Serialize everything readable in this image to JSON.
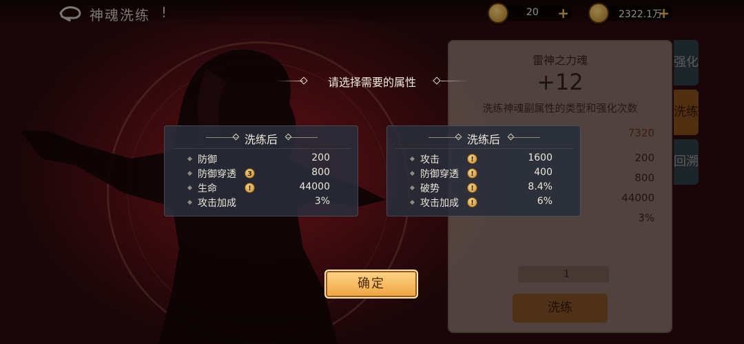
{
  "header": {
    "title": "神魂洗练",
    "title_mark": "!",
    "currencies": [
      {
        "name": "gem",
        "value": "20"
      },
      {
        "name": "gold",
        "value": "2322.1万"
      }
    ]
  },
  "side_panel": {
    "soul_name": "雷神之力魂",
    "level": "+12",
    "description": "洗练神魂副属性的类型和强化次数",
    "values": [
      "7320",
      "200",
      "800",
      "44000",
      "3%"
    ],
    "cost": "1",
    "refine_button": "洗练",
    "tabs": [
      {
        "label": "强化"
      },
      {
        "label": "洗练"
      },
      {
        "label": "回溯"
      }
    ]
  },
  "modal": {
    "prompt": "请选择需要的属性",
    "options": [
      {
        "heading": "洗练后",
        "stats": [
          {
            "name": "防御",
            "badge": "",
            "value": "200"
          },
          {
            "name": "防御穿透",
            "badge": "3",
            "value": "800"
          },
          {
            "name": "生命",
            "badge": "!",
            "value": "44000"
          },
          {
            "name": "攻击加成",
            "badge": "",
            "value": "3%"
          }
        ]
      },
      {
        "heading": "洗练后",
        "stats": [
          {
            "name": "攻击",
            "badge": "!",
            "value": "1600"
          },
          {
            "name": "防御穿透",
            "badge": "!",
            "value": "400"
          },
          {
            "name": "破势",
            "badge": "!",
            "value": "8.4%"
          },
          {
            "name": "攻击加成",
            "badge": "!",
            "value": "6%"
          }
        ]
      }
    ],
    "confirm_label": "确定"
  },
  "colors": {
    "background_red": "#9a1f26",
    "confirm_gold": "#f0a340",
    "card_bg": "#282e3a",
    "badge_gold": "#c48a2a"
  }
}
